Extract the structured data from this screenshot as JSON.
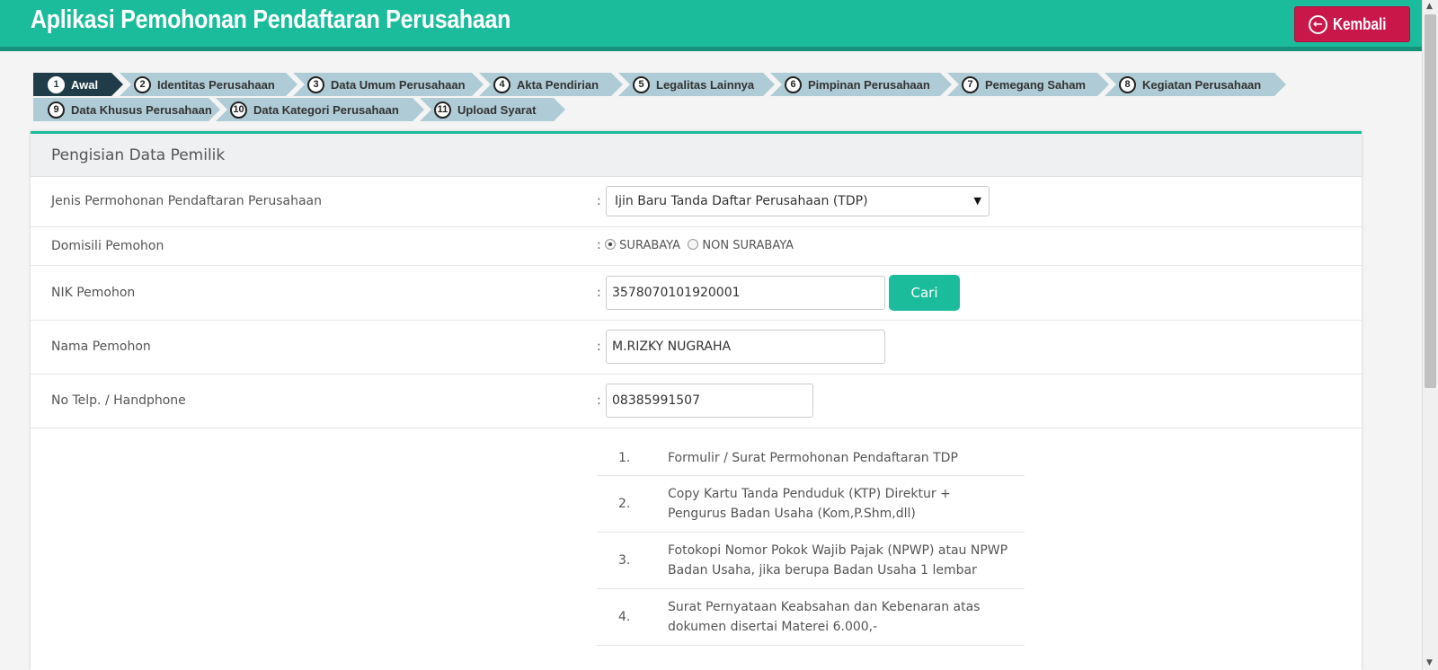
{
  "header": {
    "title": "Aplikasi Pemohonan Pendaftaran Perusahaan",
    "back_label": "Kembali",
    "back_icon_glyph": "←"
  },
  "steps": [
    {
      "num": "1",
      "label": "Awal"
    },
    {
      "num": "2",
      "label": "Identitas Perusahaan"
    },
    {
      "num": "3",
      "label": "Data Umum Perusahaan"
    },
    {
      "num": "4",
      "label": "Akta Pendirian"
    },
    {
      "num": "5",
      "label": "Legalitas Lainnya"
    },
    {
      "num": "6",
      "label": "Pimpinan Perusahaan"
    },
    {
      "num": "7",
      "label": "Pemegang Saham"
    },
    {
      "num": "8",
      "label": "Kegiatan Perusahaan"
    },
    {
      "num": "9",
      "label": "Data Khusus Perusahaan"
    },
    {
      "num": "10",
      "label": "Data Kategori Perusahaan"
    },
    {
      "num": "11",
      "label": "Upload Syarat"
    }
  ],
  "panel": {
    "title": "Pengisian Data Pemilik",
    "colon": ":",
    "jenis": {
      "label": "Jenis Permohonan Pendaftaran Perusahaan",
      "value": "Ijin Baru Tanda Daftar Perusahaan (TDP)",
      "arrow": "▼"
    },
    "domisili": {
      "label": "Domisili Pemohon",
      "option1": "SURABAYA",
      "option2": "NON SURABAYA"
    },
    "nik": {
      "label": "NIK Pemohon",
      "value": "3578070101920001",
      "button": "Cari"
    },
    "nama": {
      "label": "Nama Pemohon",
      "value": "M.RIZKY NUGRAHA"
    },
    "telp": {
      "label": "No Telp. / Handphone",
      "value": "08385991507"
    },
    "requirements": [
      {
        "num": "1.",
        "text": "Formulir / Surat Permohonan Pendaftaran TDP"
      },
      {
        "num": "2.",
        "text": "Copy Kartu Tanda Penduduk (KTP) Direktur + Pengurus Badan Usaha (Kom,P.Shm,dll)"
      },
      {
        "num": "3.",
        "text": "Fotokopi Nomor Pokok Wajib Pajak (NPWP) atau NPWP Badan Usaha, jika berupa Badan Usaha 1 lembar"
      },
      {
        "num": "4.",
        "text": "Surat Pernyataan Keabsahan dan Kebenaran atas dokumen disertai Materei 6.000,-"
      }
    ]
  },
  "scrollbar": {
    "up": "▲",
    "down": "▼"
  }
}
